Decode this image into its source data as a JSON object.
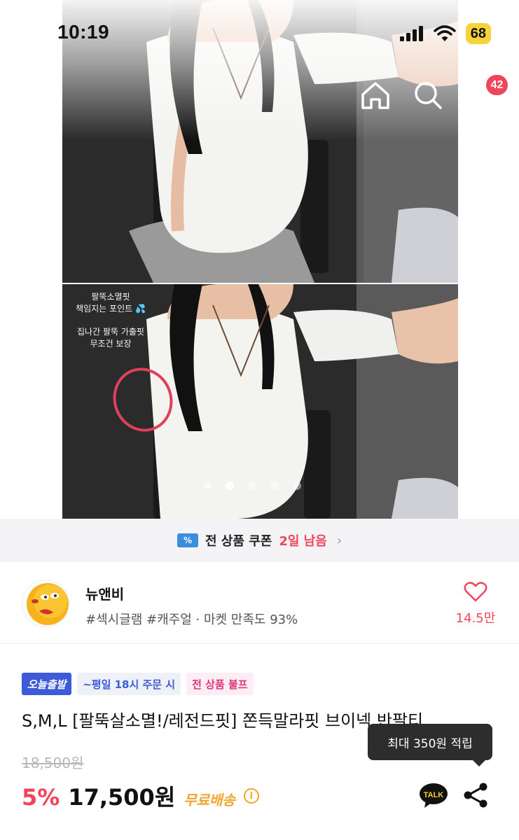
{
  "status_bar": {
    "time": "10:19",
    "battery": "68"
  },
  "nav": {
    "cart_count": "42"
  },
  "image_overlay": {
    "line1": "팔뚝소멸핏",
    "line2": "책임지는 포인트 💦",
    "line3": "집나간 팔뚝 가출핏",
    "line4": "무조건 보장"
  },
  "coupon": {
    "icon_text": "%",
    "text": "전 상품 쿠폰",
    "highlight": "2일 남음",
    "chevron": "›"
  },
  "shop": {
    "name": "뉴앤비",
    "meta": "#섹시글램 #캐주얼 · 마켓 만족도 93%",
    "likes": "14.5만"
  },
  "product": {
    "tags": [
      "오늘출발",
      "~평일 18시 주문 시",
      "전 상품 불프"
    ],
    "title": "S,M,L [팔뚝살소멸!/레전드핏] 쫀득말라핏 브이넥 반팔티",
    "original_price": "18,500원",
    "discount": "5%",
    "price": "17,500원",
    "shipping": "무료배송",
    "info_icon": "i"
  },
  "tooltip": {
    "text": "최대 350원 적립"
  },
  "icons": {
    "back": "chevron-left-icon",
    "home": "home-icon",
    "search": "search-icon",
    "cart": "shopping-bag-icon",
    "heart": "heart-icon",
    "talk": "kakaotalk-icon",
    "share": "share-icon",
    "talk_label": "TALK"
  },
  "colors": {
    "accent": "#f0455a",
    "shipping": "#f1a52a",
    "tag_blue": "#3d5bd9",
    "coupon_blue": "#3b8de0"
  }
}
